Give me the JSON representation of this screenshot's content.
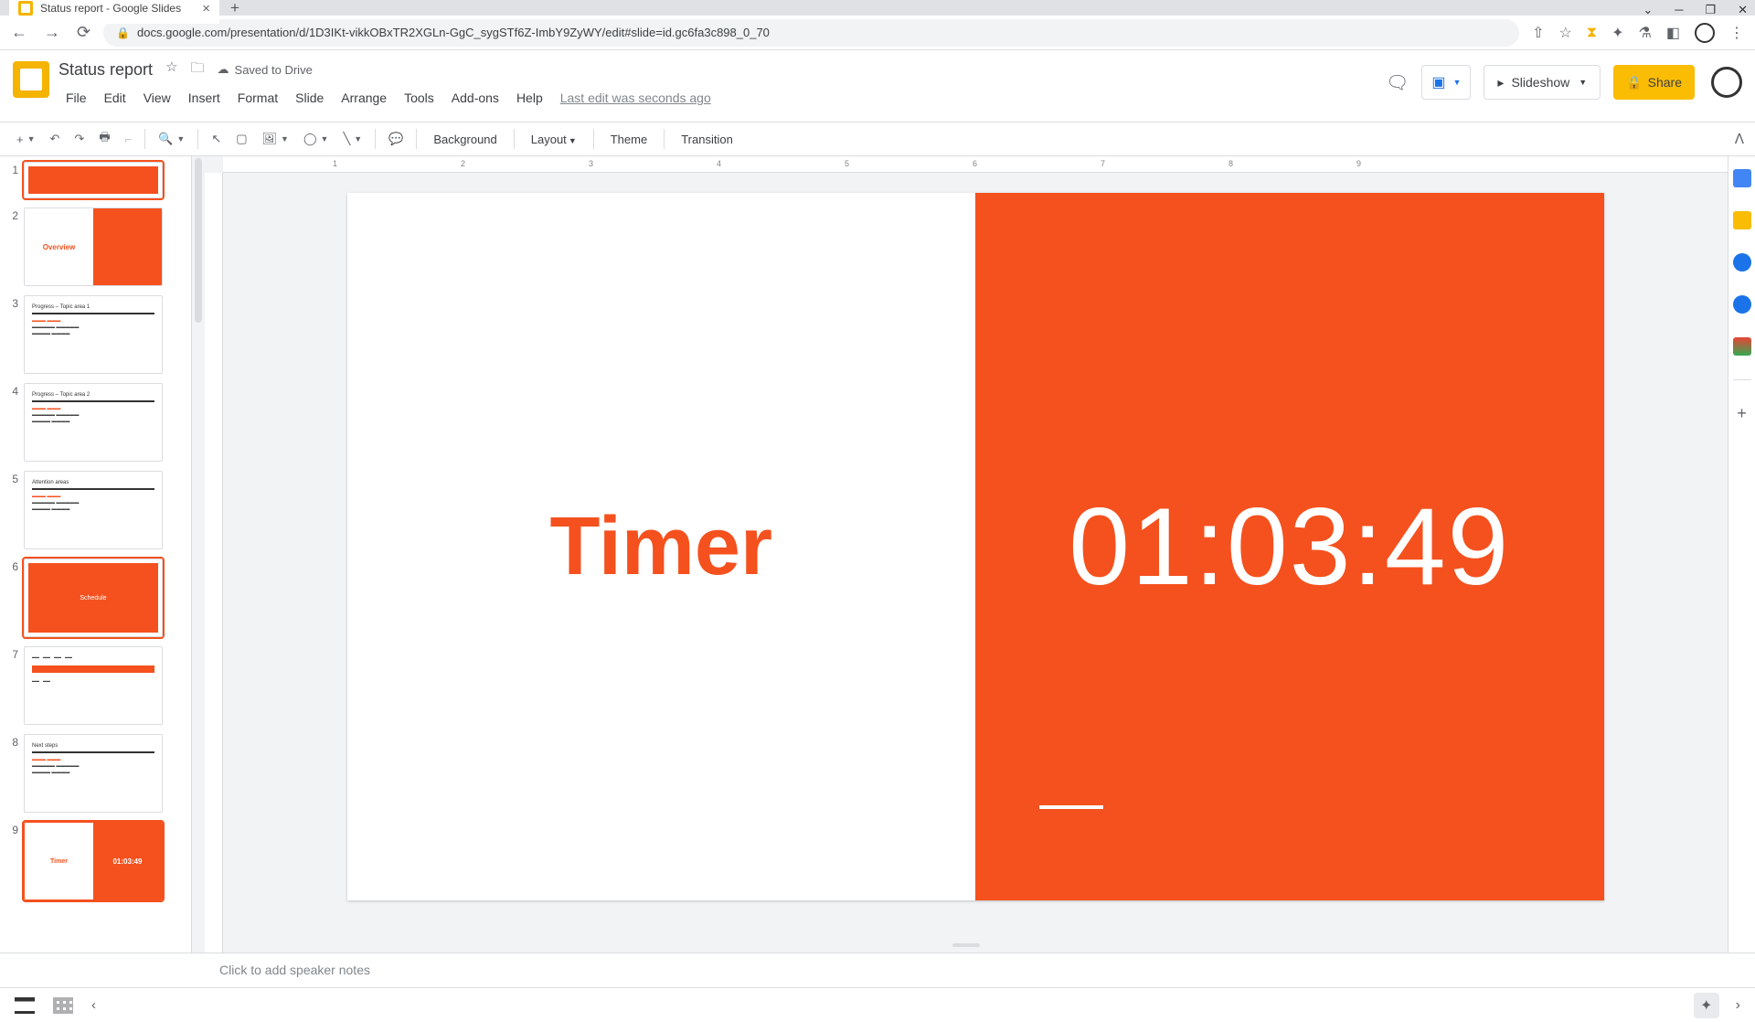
{
  "browser": {
    "tab_title": "Status report - Google Slides",
    "url": "docs.google.com/presentation/d/1D3IKt-vikkOBxTR2XGLn-GgC_sygSTf6Z-ImbY9ZyWY/edit#slide=id.gc6fa3c898_0_70"
  },
  "header": {
    "doc_title": "Status report",
    "saved_text": "Saved to Drive",
    "last_edit": "Last edit was seconds ago",
    "slideshow_label": "Slideshow",
    "share_label": "Share",
    "menu": [
      "File",
      "Edit",
      "View",
      "Insert",
      "Format",
      "Slide",
      "Arrange",
      "Tools",
      "Add-ons",
      "Help"
    ]
  },
  "toolbar": {
    "background": "Background",
    "layout": "Layout",
    "theme": "Theme",
    "transition": "Transition"
  },
  "filmstrip": {
    "slides": [
      {
        "num": "1",
        "kind": "full-orange",
        "label": ""
      },
      {
        "num": "2",
        "kind": "split",
        "label": "Overview"
      },
      {
        "num": "3",
        "kind": "text",
        "label": "Progress – Topic area 1"
      },
      {
        "num": "4",
        "kind": "text",
        "label": "Progress – Topic area 2"
      },
      {
        "num": "5",
        "kind": "text",
        "label": "Attention areas"
      },
      {
        "num": "6",
        "kind": "full-orange",
        "label": "Schedule"
      },
      {
        "num": "7",
        "kind": "timeline",
        "label": ""
      },
      {
        "num": "8",
        "kind": "text",
        "label": "Next steps"
      },
      {
        "num": "9",
        "kind": "timer",
        "label": "Timer",
        "value": "01:03:49"
      }
    ],
    "selected": 9
  },
  "canvas": {
    "title": "Timer",
    "timer_value": "01:03:49"
  },
  "notes": {
    "placeholder": "Click to add speaker notes"
  },
  "ruler": {
    "marks": [
      "1",
      "2",
      "3",
      "4",
      "5",
      "6",
      "7",
      "8",
      "9"
    ]
  },
  "colors": {
    "accent": "#f4511e",
    "share": "#fbbc04"
  }
}
